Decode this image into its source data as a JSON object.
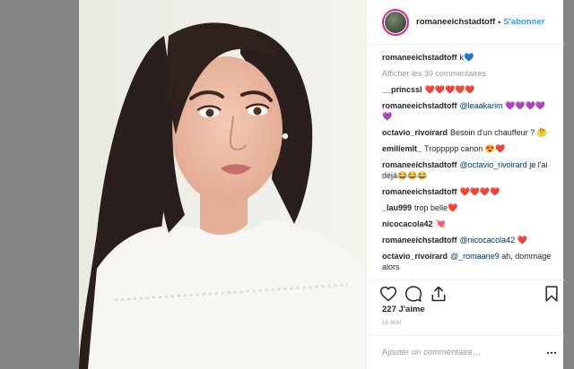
{
  "post": {
    "image_alt": "Selfie photo",
    "author": "romaneeichstadtoff",
    "separator": "•",
    "follow_label": "S'abonner",
    "caption_text": "k💙",
    "load_more": "Afficher les 30 commentaires",
    "comments": [
      {
        "user": "__princssl",
        "mention": "",
        "text": "❤️❤️❤️❤️❤️"
      },
      {
        "user": "romaneeichstadtoff",
        "mention": "@leaakarim",
        "text": "💜💜💜💜💜"
      },
      {
        "user": "octavio_rivoirard",
        "mention": "",
        "text": "Besoin d'un chauffeur ? 🤔"
      },
      {
        "user": "emiliemlt_",
        "mention": "",
        "text": "Troppppp canon 😍❤️"
      },
      {
        "user": "romaneeichstadtoff",
        "mention": "@octavio_rivoirard",
        "text": "je l'ai déjà😂😂😂"
      },
      {
        "user": "romaneeichstadtoff",
        "mention": "",
        "text": "❤️❤️❤️❤️"
      },
      {
        "user": "_lau999",
        "mention": "",
        "text": "trop belle❤️"
      },
      {
        "user": "nicocacola42",
        "mention": "",
        "text": "💘"
      },
      {
        "user": "romaneeichstadtoff",
        "mention": "@nicocacola42",
        "text": "❤️"
      },
      {
        "user": "octavio_rivoirard",
        "mention": "@_romaane9",
        "text": "ah, dommage alors"
      }
    ],
    "likes": "227 J'aime",
    "date": "15 MAI",
    "add_comment_placeholder": "Ajouter un commentaire…"
  },
  "icons": {
    "like": "heart-icon",
    "comment": "comment-icon",
    "share": "share-icon",
    "save": "bookmark-icon",
    "more": "more-options-icon"
  },
  "colors": {
    "link": "#3897f0",
    "text": "#262626",
    "muted": "#999999",
    "overlay": "#858585"
  }
}
